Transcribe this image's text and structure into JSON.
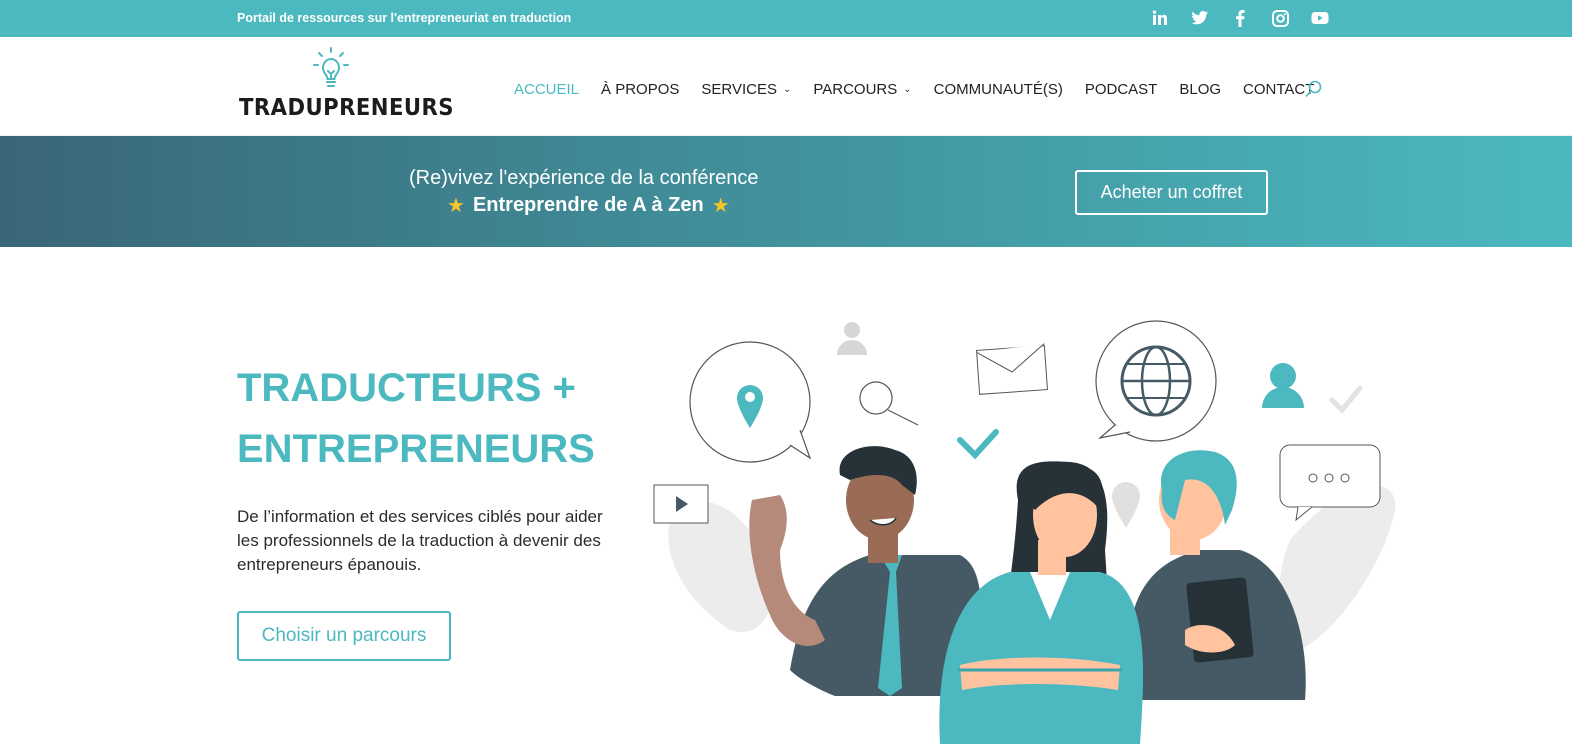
{
  "topbar": {
    "tagline": "Portail de ressources sur l'entrepreneuriat en traduction",
    "socials": [
      "linkedin-icon",
      "twitter-icon",
      "facebook-icon",
      "instagram-icon",
      "youtube-icon"
    ]
  },
  "header": {
    "logo_text": "TRADUPRENEURS",
    "nav": [
      {
        "label": "ACCUEIL",
        "active": true
      },
      {
        "label": "À PROPOS"
      },
      {
        "label": "SERVICES",
        "has_dropdown": true
      },
      {
        "label": "PARCOURS",
        "has_dropdown": true
      },
      {
        "label": "COMMUNAUTÉ(S)"
      },
      {
        "label": "PODCAST"
      },
      {
        "label": "BLOG"
      },
      {
        "label": "CONTACT"
      }
    ]
  },
  "banner": {
    "line1": "(Re)vivez l'expérience de la conférence",
    "line2": "Entreprendre de A à Zen",
    "button": "Acheter un coffret"
  },
  "hero": {
    "title_line1": "TRADUCTEURS +",
    "title_line2": "ENTREPRENEURS",
    "description": "De l’information et des services ciblés pour aider les professionnels de la traduction à devenir des entrepreneurs épanouis.",
    "button": "Choisir un parcours"
  },
  "colors": {
    "accent": "#4bb9bf",
    "dark": "#455a64",
    "banner_start": "#3a6677"
  }
}
